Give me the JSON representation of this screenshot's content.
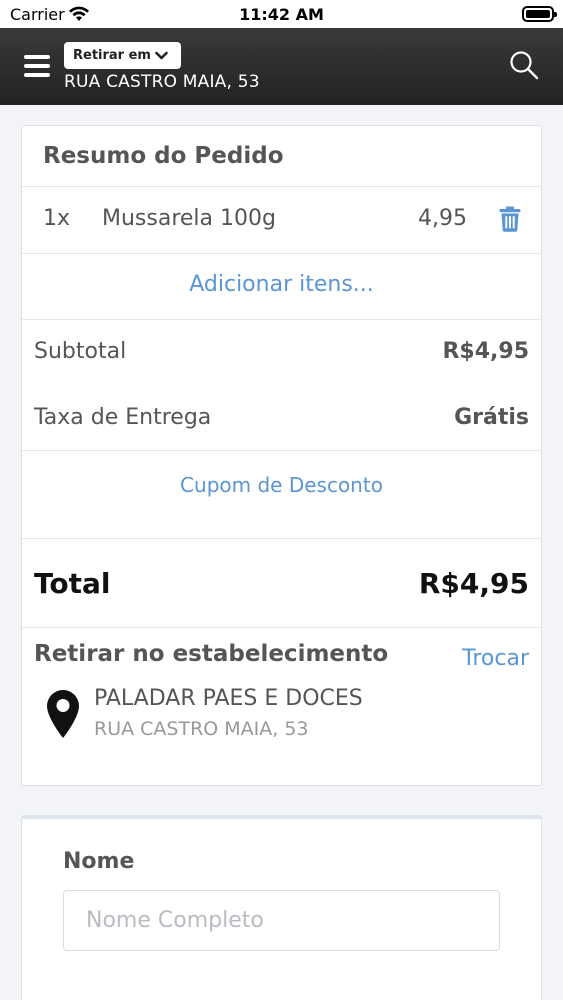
{
  "status_bar": {
    "carrier": "Carrier",
    "time": "11:42 AM"
  },
  "header": {
    "mode_label": "Retirar em",
    "address": "RUA CASTRO MAIA, 53"
  },
  "order": {
    "title": "Resumo do Pedido",
    "items": [
      {
        "qty": "1x",
        "name": "Mussarela 100g",
        "price": "4,95"
      }
    ],
    "add_items_label": "Adicionar itens...",
    "subtotal_label": "Subtotal",
    "subtotal_value": "R$4,95",
    "delivery_label": "Taxa de Entrega",
    "delivery_value": "Grátis",
    "coupon_label": "Cupom de Desconto",
    "total_label": "Total",
    "total_value": "R$4,95"
  },
  "pickup": {
    "title": "Retirar no estabelecimento",
    "change_label": "Trocar",
    "store_name": "PALADAR PAES E DOCES",
    "store_address": "RUA CASTRO MAIA, 53"
  },
  "form": {
    "name_label": "Nome",
    "name_placeholder": "Nome Completo"
  },
  "colors": {
    "link": "#5b95d2",
    "header": "#2b2b2b",
    "text": "#555555"
  }
}
